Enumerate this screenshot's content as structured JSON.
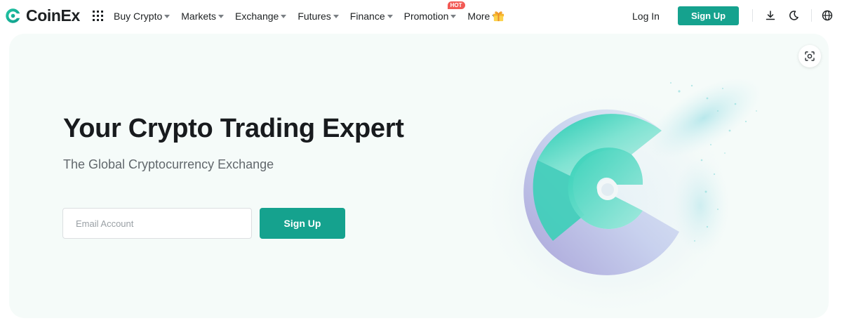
{
  "brand": {
    "name": "CoinEx",
    "accent": "#15a28e"
  },
  "nav": {
    "items": [
      {
        "label": "Buy Crypto",
        "has_dropdown": true
      },
      {
        "label": "Markets",
        "has_dropdown": true
      },
      {
        "label": "Exchange",
        "has_dropdown": true
      },
      {
        "label": "Futures",
        "has_dropdown": true
      },
      {
        "label": "Finance",
        "has_dropdown": true
      },
      {
        "label": "Promotion",
        "has_dropdown": true,
        "badge": "HOT"
      },
      {
        "label": "More",
        "has_dropdown": true
      }
    ],
    "gift_icon": "gift-icon",
    "apps_icon": "apps-grid-icon"
  },
  "auth": {
    "login_label": "Log In",
    "signup_label": "Sign Up"
  },
  "header_icons": [
    "download-icon",
    "moon-icon",
    "globe-icon"
  ],
  "hero": {
    "title": "Your Crypto Trading Expert",
    "subtitle": "The Global Cryptocurrency Exchange",
    "email_placeholder": "Email Account",
    "email_value": "",
    "signup_label": "Sign Up",
    "scan_icon": "scan-icon",
    "art": "coinex-3d-logo-illustration"
  }
}
